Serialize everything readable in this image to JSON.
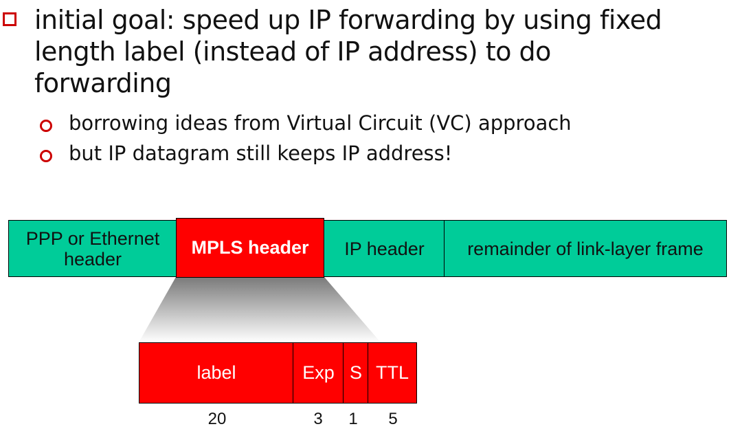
{
  "bullets": {
    "main": "initial goal: speed up IP forwarding by using fixed length label (instead of IP address) to do forwarding",
    "sub": [
      "borrowing ideas from Virtual Circuit (VC) approach",
      "but IP datagram still keeps IP address!"
    ]
  },
  "frame": {
    "ppp": "PPP or Ethernet header",
    "mpls": "MPLS header",
    "ip": "IP header",
    "remainder": "remainder of link-layer frame"
  },
  "mpls_fields": [
    {
      "name": "label",
      "bits": "20"
    },
    {
      "name": "Exp",
      "bits": "3"
    },
    {
      "name": "S",
      "bits": "1"
    },
    {
      "name": "TTL",
      "bits": "5"
    }
  ],
  "colors": {
    "teal": "#00cc99",
    "red": "#ff0000",
    "bullet": "#cc0000"
  }
}
